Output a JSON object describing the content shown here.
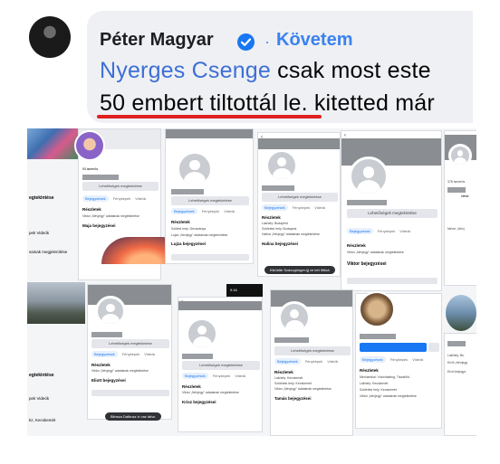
{
  "comment": {
    "author": "Péter Magyar",
    "separator": "·",
    "follow_label": "Követem",
    "mention": "Nyerges Csenge",
    "text_line1_rest": "csak most este",
    "text_line2": "50 embert tiltottál le. kitetted már"
  },
  "colors": {
    "accent_blue": "#1877f2",
    "underline_red": "#e02020"
  },
  "icons": {
    "verified": "verified-badge-icon",
    "back": "chevron-left-icon"
  },
  "shots": {
    "common_more_label": "Lehetőségek megtekintése",
    "common_tabs": [
      "Bejegyzések",
      "Fényképek",
      "Videók"
    ],
    "details_heading": "Részletek",
    "posts_heading": "Viktor bejegyzései",
    "posts_heading_2": "Lujza bejegyzései",
    "posts_heading_3": "Halina bejegyzései",
    "posts_heading_4": "Krisz bejegyzései",
    "posts_heading_5": "Tamás bejegyzései",
    "posts_heading_6": "Eliott bejegyzései",
    "posts_heading_7": "Maja bejegyzései",
    "about_line_1": "Viktor „Névjegy\" adatainak megtekintése",
    "about_line_2": "Lujza „Névjegy\" adatainak megtekintése",
    "about_line_3": "Halina „Névjegy\" adatainak megtekintése",
    "location_1": "Lakhely: Budapest",
    "location_2": "Születési hely: Budapest",
    "location_3": "Lakhely: Kecskemét",
    "location_4": "Születési hely: Kecskemét",
    "location_5": "Szülési hely: Dévaványa",
    "school": "Mechanikai: Vidordasting, Tiszaföld",
    "toast_1": "Kiküldte Szávogünger-ijj ve két ittítoá",
    "toast_2": "Blinsza Dalbusz ix vaz táha.",
    "left_tabs_1": "pek  Videók",
    "left_tabs_2": "pek  Videók",
    "left_more": "egtekintése",
    "left_more_2": "egtekintése",
    "left_about": "sainak megjelenítése",
    "left_city": "kz, Kecskemét",
    "right_more": "ntése",
    "right_about": "Névre „Névj",
    "right_details_1": "Lakhely: Bu",
    "right_details_2": "Erről „Névjegy",
    "right_posts": "Ernő bejegyz",
    "right_count": "378 Ismerős",
    "friends_count": "93 ismerős",
    "status_time": "9:16"
  }
}
